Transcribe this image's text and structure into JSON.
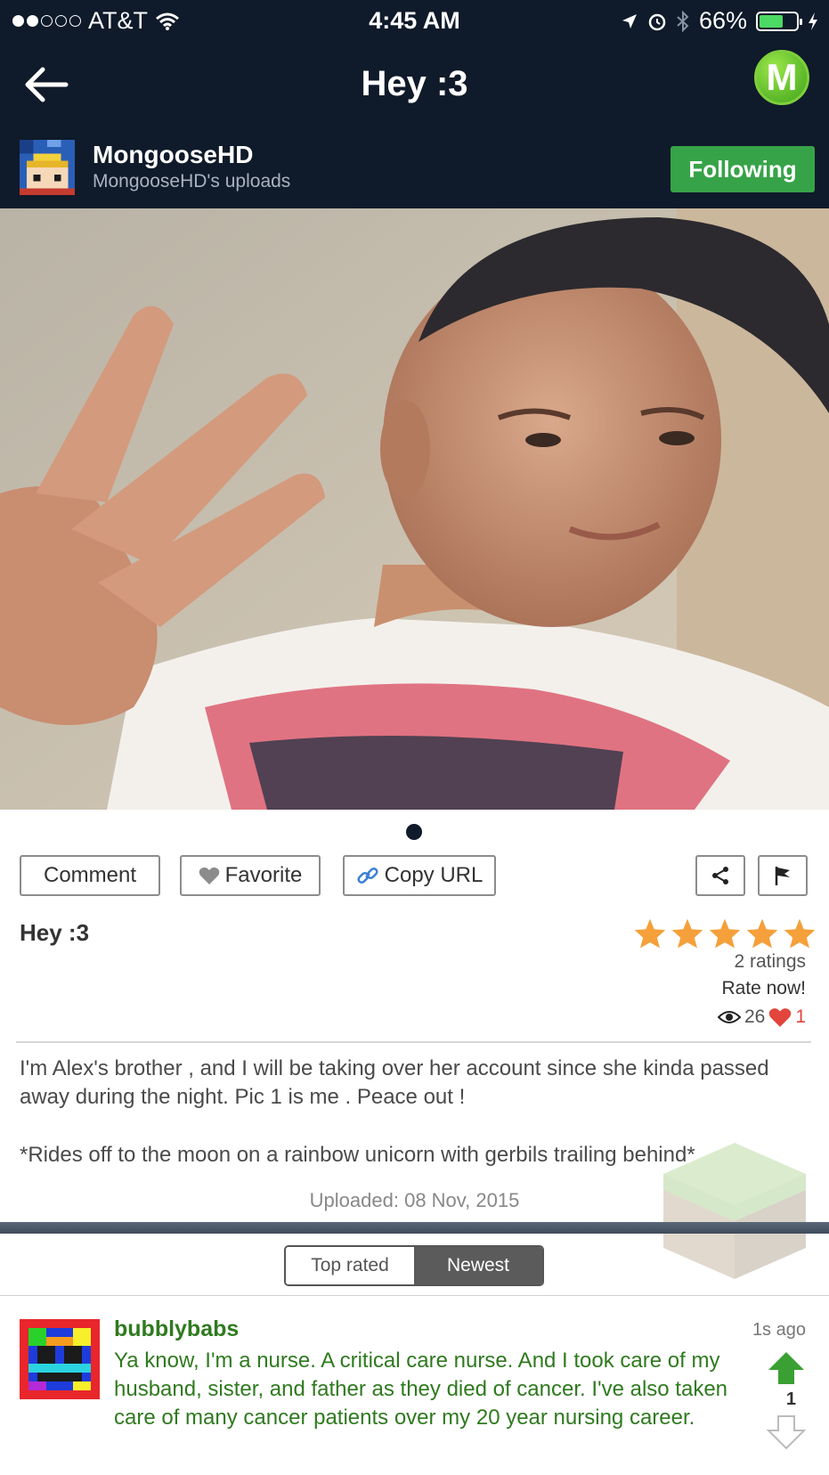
{
  "status_bar": {
    "carrier": "AT&T",
    "time": "4:45 AM",
    "battery": "66%",
    "battery_level": 0.66,
    "signal_bars": 2
  },
  "header": {
    "back_icon": "back-arrow-icon",
    "title": "Hey :3",
    "app_badge": "M"
  },
  "uploader": {
    "name": "MongooseHD",
    "subtitle": "MongooseHD's uploads",
    "follow_label": "Following"
  },
  "actions": {
    "comment": "Comment",
    "favorite": "Favorite",
    "copy_url": "Copy URL",
    "share_icon": "share-icon",
    "flag_icon": "flag-icon"
  },
  "post": {
    "title": "Hey :3",
    "stars": 5,
    "ratings": "2 ratings",
    "rate_now": "Rate now!",
    "views": "26",
    "likes": "1",
    "description_1": "I'm Alex's brother , and I will be taking over her account since she kinda passed away during the night. Pic 1 is me . Peace out !",
    "description_2": "*Rides off to the moon on a rainbow unicorn with gerbils trailing behind*",
    "uploaded": "Uploaded: 08 Nov, 2015"
  },
  "comment_tabs": {
    "top_rated": "Top rated",
    "newest": "Newest",
    "active": "newest"
  },
  "comment": {
    "user": "bubblybabs",
    "text": "Ya know, I'm a nurse. A critical care nurse. And I took care of my husband, sister, and father as they died of cancer. I've also taken care of many cancer patients over my 20 year nursing career.",
    "time": "1s ago",
    "votes": "1"
  },
  "colors": {
    "header_bg": "#0f1a2a",
    "follow_green": "#37a348",
    "comment_green": "#2f7a1f",
    "star_orange": "#f5a03a",
    "like_red": "#e2453c"
  }
}
